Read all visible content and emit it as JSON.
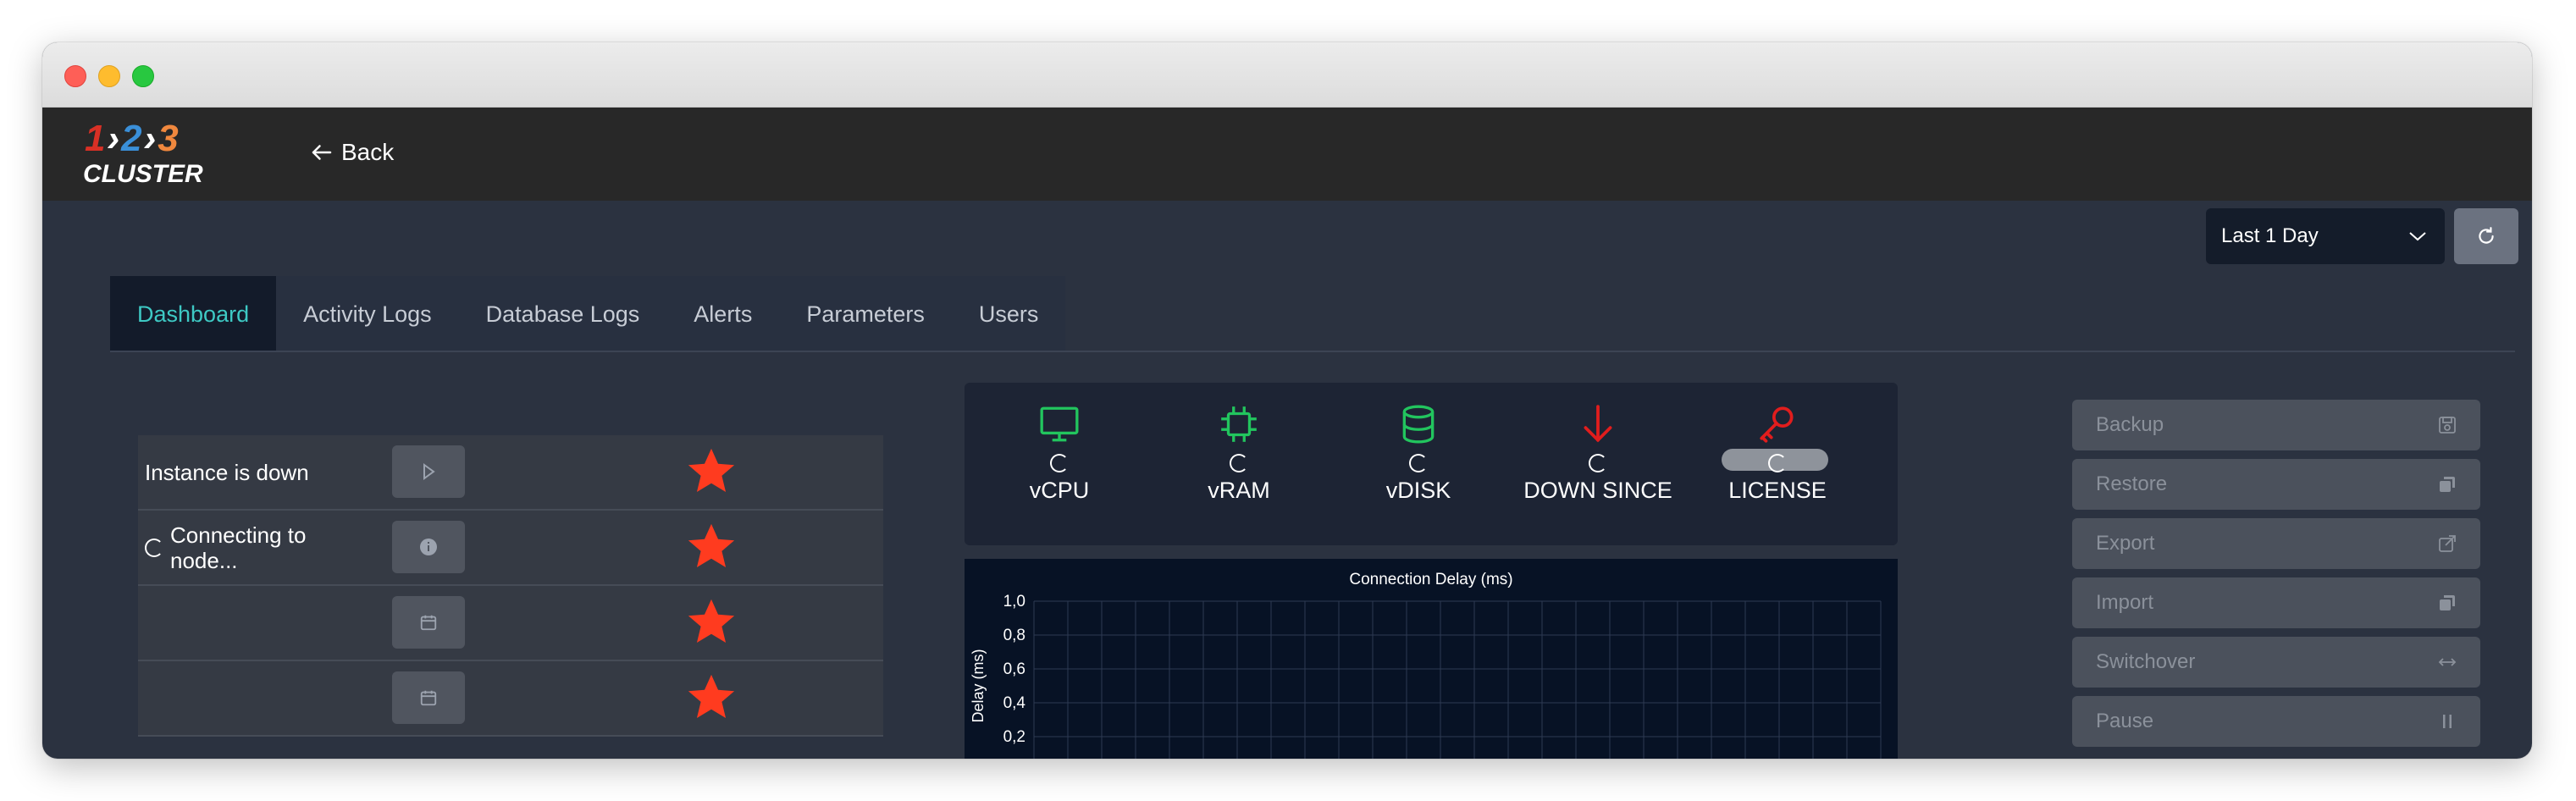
{
  "app": {
    "logo_numbers": [
      "1",
      "2",
      "3"
    ],
    "logo_text": "CLUSTER",
    "colors": {
      "one": "#d93025",
      "two": "#3a8fd8",
      "three": "#f0883e",
      "accent": "#3ec9c4"
    }
  },
  "header": {
    "back_label": "Back"
  },
  "toolbar": {
    "range_value": "Last 1 Day",
    "refresh_icon": "refresh-icon"
  },
  "tabs": [
    {
      "label": "Dashboard",
      "active": true
    },
    {
      "label": "Activity Logs"
    },
    {
      "label": "Database Logs"
    },
    {
      "label": "Alerts"
    },
    {
      "label": "Parameters"
    },
    {
      "label": "Users"
    }
  ],
  "instances": [
    {
      "label": "Instance is down",
      "button_icon": "play-icon"
    },
    {
      "label": "Connecting to node...",
      "loading": true,
      "button_icon": "info-icon"
    },
    {
      "label": "",
      "button_icon": "calendar-icon"
    },
    {
      "label": "",
      "button_icon": "calendar-icon"
    }
  ],
  "stats": [
    {
      "label": "vCPU",
      "icon": "monitor-icon",
      "color": "#22c55e"
    },
    {
      "label": "vRAM",
      "icon": "chip-icon",
      "color": "#22c55e"
    },
    {
      "label": "vDISK",
      "icon": "database-icon",
      "color": "#22c55e"
    },
    {
      "label": "DOWN SINCE",
      "icon": "arrow-down-icon",
      "color": "#e11d1d"
    },
    {
      "label": "LICENSE",
      "icon": "key-icon",
      "color": "#e11d1d"
    }
  ],
  "chart_data": {
    "type": "line",
    "title": "Connection Delay (ms)",
    "ylabel": "Delay (ms)",
    "xlabel": "",
    "yticks": [
      "1,0",
      "0,8",
      "0,6",
      "0,4",
      "0,2"
    ],
    "ylim": [
      0,
      1
    ],
    "series": [],
    "grid": true
  },
  "actions": [
    {
      "label": "Backup",
      "icon": "save-icon"
    },
    {
      "label": "Restore",
      "icon": "copy-icon"
    },
    {
      "label": "Export",
      "icon": "share-icon"
    },
    {
      "label": "Import",
      "icon": "copy-icon"
    },
    {
      "label": "Switchover",
      "icon": "arrows-horizontal-icon"
    },
    {
      "label": "Pause",
      "icon": "pause-icon"
    }
  ]
}
